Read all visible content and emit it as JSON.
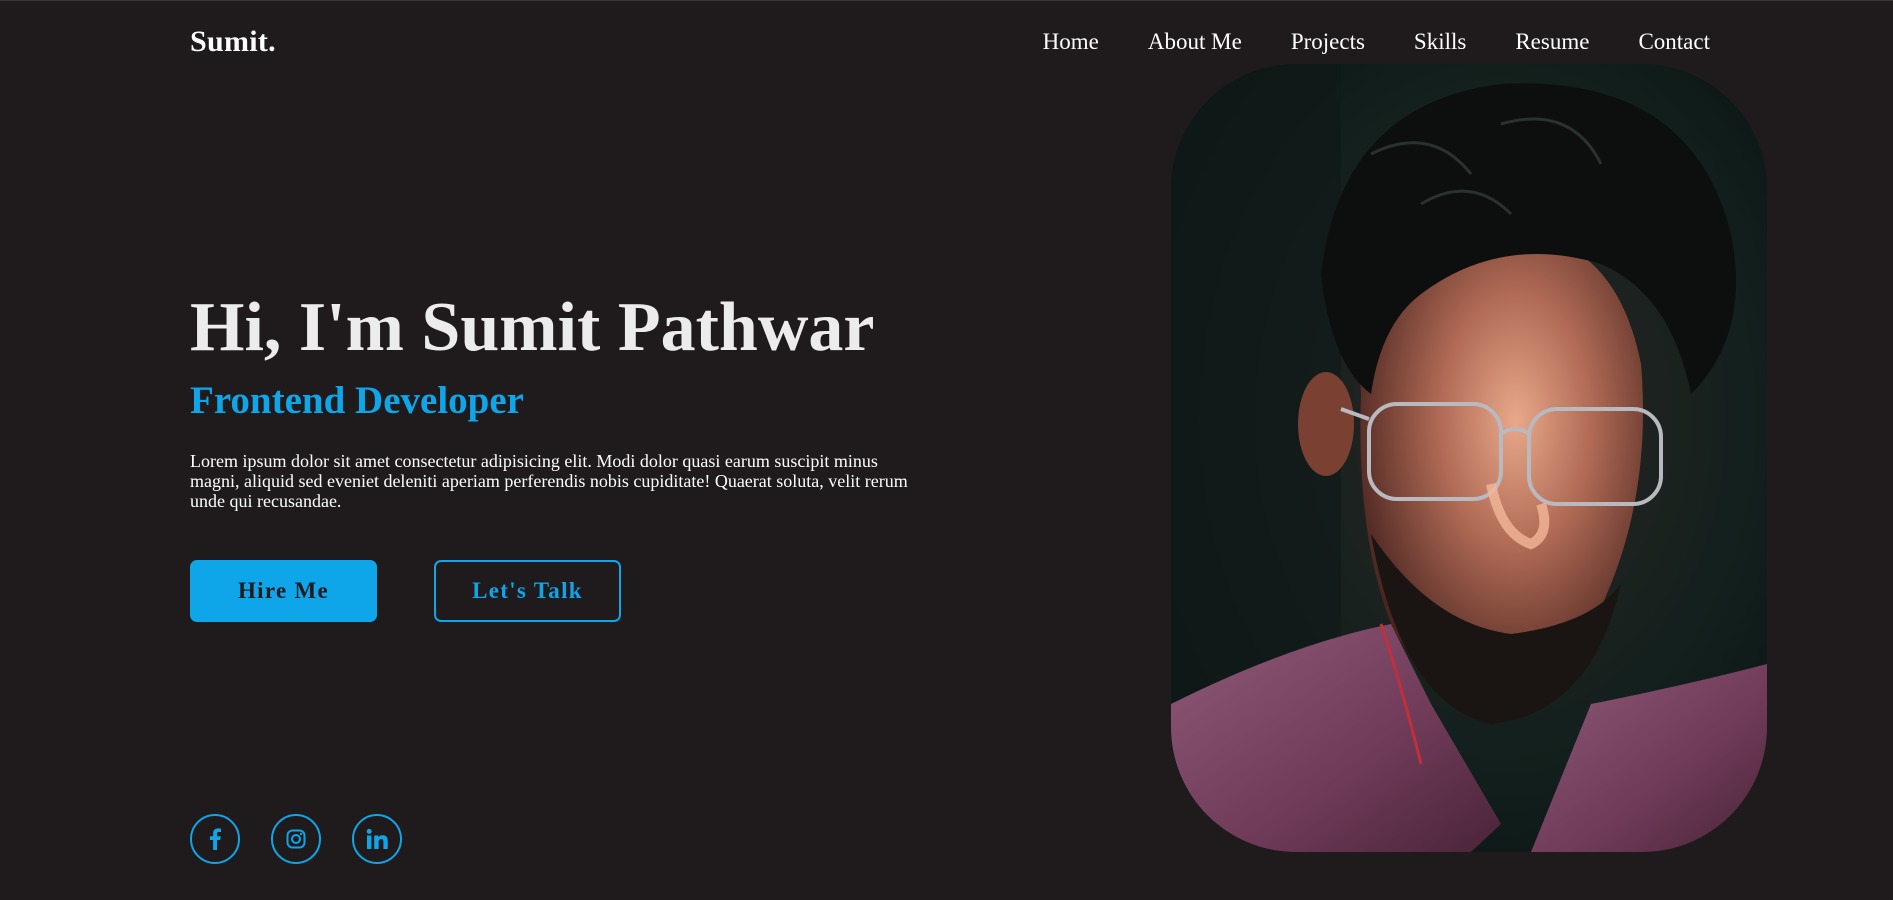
{
  "brand": {
    "logo": "Sumit."
  },
  "nav": {
    "items": [
      {
        "label": "Home"
      },
      {
        "label": "About Me"
      },
      {
        "label": "Projects"
      },
      {
        "label": "Skills"
      },
      {
        "label": "Resume"
      },
      {
        "label": "Contact"
      }
    ]
  },
  "hero": {
    "title": "Hi, I'm Sumit Pathwar",
    "subtitle": "Frontend Developer",
    "description": "Lorem ipsum dolor sit amet consectetur adipisicing elit. Modi dolor quasi earum suscipit minus magni, aliquid sed eveniet deleniti aperiam perferendis nobis cupiditate! Quaerat soluta, velit rerum unde qui recusandae.",
    "buttons": {
      "primary": "Hire Me",
      "secondary": "Let's Talk"
    },
    "portrait_alt": "portrait-photo"
  },
  "social": [
    {
      "icon": "facebook-icon"
    },
    {
      "icon": "instagram-icon"
    },
    {
      "icon": "linkedin-icon"
    }
  ],
  "colors": {
    "background": "#1f1b1d",
    "accent": "#0ea5e9",
    "text": "#ffffff",
    "heading": "#ececec"
  }
}
